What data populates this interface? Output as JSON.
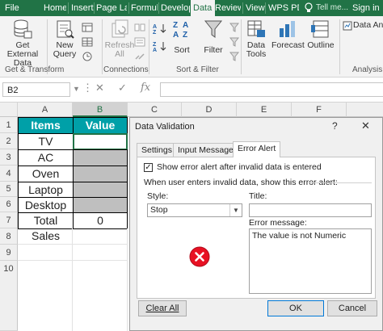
{
  "ribbon_tabs": [
    "File",
    "Home",
    "Insert",
    "Page La",
    "Formul",
    "Develop",
    "Data",
    "Review",
    "View",
    "WPS PD"
  ],
  "active_tab": "Data",
  "tell_me": "Tell me...",
  "sign_in": "Sign in",
  "ribbon": {
    "get_external_data": [
      "Get External",
      "Data"
    ],
    "new_query": [
      "New",
      "Query"
    ],
    "refresh_all": [
      "Refresh",
      "All"
    ],
    "sort": "Sort",
    "filter": "Filter",
    "data_tools": [
      "Data",
      "Tools"
    ],
    "forecast": "Forecast",
    "outline": "Outline",
    "data_analysis": "Data Anal",
    "sort_za": "Z↓A",
    "groups": {
      "get_transform": "Get & Transform",
      "connections": "Connections",
      "sort_filter": "Sort & Filter",
      "analysis": "Analysis"
    }
  },
  "formula_bar": {
    "name_box": "B2",
    "cancel": "✕",
    "enter": "✓",
    "fx": "fx",
    "value": ""
  },
  "columns": [
    "A",
    "B",
    "C",
    "D",
    "E",
    "F"
  ],
  "rows": [
    "1",
    "2",
    "3",
    "4",
    "5",
    "6",
    "7",
    "8",
    "9",
    "10"
  ],
  "sheet": {
    "header_items": "Items",
    "header_value": "Value",
    "items": [
      "TV",
      "AC",
      "Oven",
      "Laptop",
      "Desktop"
    ],
    "total_label": "Total Sales",
    "total_value": "0"
  },
  "dialog": {
    "title": "Data Validation",
    "help": "?",
    "close": "✕",
    "tabs": [
      "Settings",
      "Input Message",
      "Error Alert"
    ],
    "active_tab": "Error Alert",
    "show_error_checkbox": "Show error alert after invalid data is entered",
    "show_error_checked": true,
    "instruction": "When user enters invalid data, show this error alert:",
    "style_label": "Style:",
    "style_value": "Stop",
    "title_label": "Title:",
    "title_value": "",
    "error_message_label": "Error message:",
    "error_message_value": "The value is not Numeric",
    "clear_all": "Clear All",
    "ok": "OK",
    "cancel": "Cancel"
  },
  "colors": {
    "excel_green": "#217346",
    "header_teal": "#00a0a8",
    "input_gray": "#bfbfbf",
    "error_red": "#e81123"
  }
}
